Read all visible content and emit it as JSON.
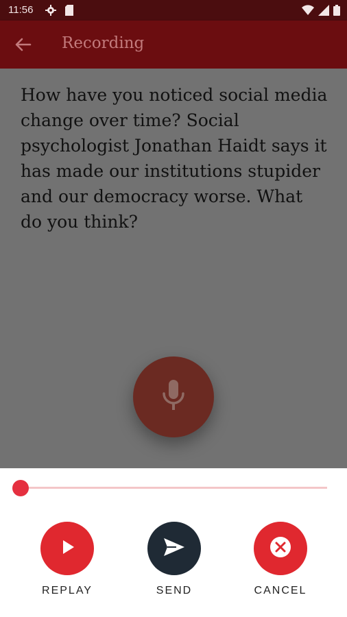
{
  "status_bar": {
    "time": "11:56",
    "icons": [
      "gear-icon",
      "sd-card-icon",
      "wifi-icon",
      "signal-icon",
      "battery-icon"
    ]
  },
  "app_bar": {
    "title": "Recording",
    "back_icon": "arrow-left-icon"
  },
  "main": {
    "question": "How have you noticed social media change over time? Social psychologist Jonathan Haidt says it has made our institutions stupider and our democracy worse. What do you think?",
    "mic_icon": "microphone-icon"
  },
  "player": {
    "progress": 0.0
  },
  "controls": {
    "replay_label": "REPLAY",
    "send_label": "SEND",
    "cancel_label": "CANCEL"
  },
  "colors": {
    "status_bar": "#4b0d0f",
    "app_bar": "#6b0d10",
    "accent_red": "#e0282f",
    "send_dark": "#1f2a35",
    "overlay": "#727272"
  }
}
